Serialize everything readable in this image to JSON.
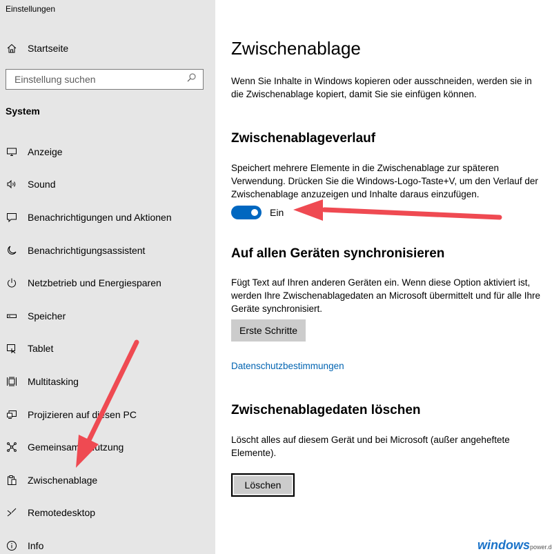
{
  "app": {
    "title": "Einstellungen"
  },
  "sidebar": {
    "home_label": "Startseite",
    "search_placeholder": "Einstellung suchen",
    "section_title": "System",
    "items": [
      {
        "label": "Anzeige",
        "icon": "monitor-icon"
      },
      {
        "label": "Sound",
        "icon": "speaker-icon"
      },
      {
        "label": "Benachrichtigungen und Aktionen",
        "icon": "notification-icon"
      },
      {
        "label": "Benachrichtigungsassistent",
        "icon": "moon-icon"
      },
      {
        "label": "Netzbetrieb und Energiesparen",
        "icon": "power-icon"
      },
      {
        "label": "Speicher",
        "icon": "storage-icon"
      },
      {
        "label": "Tablet",
        "icon": "tablet-icon"
      },
      {
        "label": "Multitasking",
        "icon": "multitasking-icon"
      },
      {
        "label": "Projizieren auf diesen PC",
        "icon": "project-icon"
      },
      {
        "label": "Gemeinsame Nutzung",
        "icon": "share-icon"
      },
      {
        "label": "Zwischenablage",
        "icon": "clipboard-icon"
      },
      {
        "label": "Remotedesktop",
        "icon": "remote-desktop-icon"
      },
      {
        "label": "Info",
        "icon": "info-icon"
      }
    ]
  },
  "main": {
    "title": "Zwischenablage",
    "intro": "Wenn Sie Inhalte in Windows kopieren oder ausschneiden, werden sie in die Zwischenablage kopiert, damit Sie sie einfügen können.",
    "history": {
      "heading": "Zwischenablageverlauf",
      "description": "Speichert mehrere Elemente in die Zwischenablage zur späteren Verwendung. Drücken Sie die Windows-Logo-Taste+V, um den Verlauf der Zwischenablage anzuzeigen und Inhalte daraus einzufügen.",
      "toggle_state": "Ein",
      "toggle_on": true
    },
    "sync": {
      "heading": "Auf allen Geräten synchronisieren",
      "description": "Fügt Text auf Ihren anderen Geräten ein. Wenn diese Option aktiviert ist, werden Ihre Zwischenablagedaten an Microsoft übermittelt und für alle Ihre Geräte synchronisiert.",
      "button_label": "Erste Schritte",
      "link_label": "Datenschutzbestimmungen"
    },
    "clear": {
      "heading": "Zwischenablagedaten löschen",
      "description": "Löscht alles auf diesem Gerät und bei Microsoft (außer angeheftete Elemente).",
      "button_label": "Löschen"
    }
  },
  "watermark": {
    "brand": "windows",
    "suffix": "power.de"
  },
  "colors": {
    "accent": "#0067c0",
    "sidebar_bg": "#e6e6e6",
    "annotation_arrow": "#ef4a52",
    "link": "#0063b1"
  }
}
